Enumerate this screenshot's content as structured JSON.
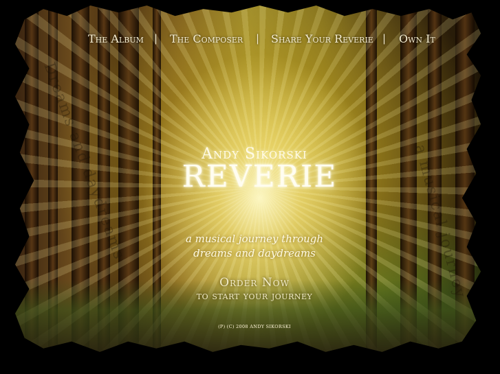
{
  "nav": {
    "items": [
      {
        "label": "The Album"
      },
      {
        "label": "The Composer"
      },
      {
        "label": "Share Your Reverie"
      },
      {
        "label": "Own It"
      }
    ],
    "separator": "|"
  },
  "hero": {
    "artist": "Andy Sikorski",
    "title": "REVERIE",
    "tagline_line1": "a musical journey through",
    "tagline_line2": "dreams and daydreams"
  },
  "cta": {
    "line1": "Order Now",
    "line2": "to start your journey"
  },
  "footer": {
    "copyright": "(P) (C) 2008 ANDY SIKORSKI"
  },
  "background": {
    "ghost_text_left": "Dreams and daydreams",
    "ghost_text_right": "a musical journey"
  }
}
